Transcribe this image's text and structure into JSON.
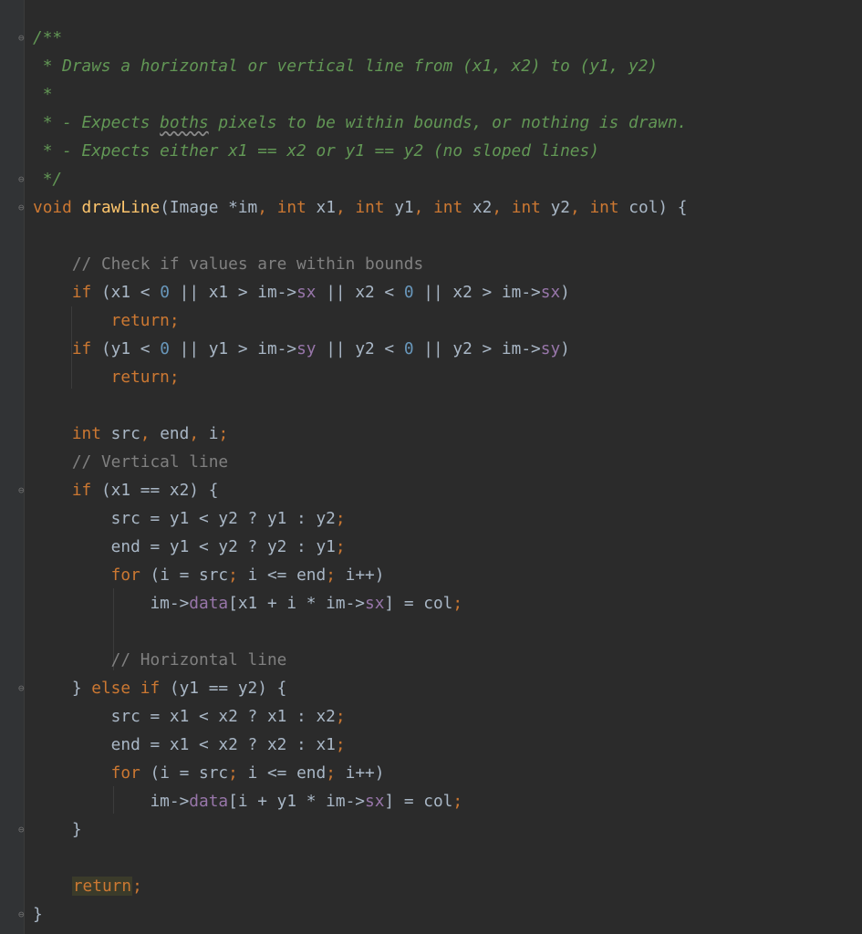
{
  "editor": {
    "lines": [
      [
        "/**"
      ],
      [
        " * Draws a horizontal or vertical line from (x1, x2) to (y1, y2)"
      ],
      [
        " *"
      ],
      [
        " * - Expects ",
        "boths",
        " pixels to be within bounds, or nothing is drawn."
      ],
      [
        " * - Expects either x1 == x2 or y1 == y2 (no sloped lines)"
      ],
      [
        " */"
      ],
      [
        "void",
        " ",
        "drawLine",
        "(Image *im",
        ",",
        " ",
        "int",
        " x1",
        ",",
        " ",
        "int",
        " y1",
        ",",
        " ",
        "int",
        " x2",
        ",",
        " ",
        "int",
        " y2",
        ",",
        " ",
        "int",
        " col) {"
      ],
      [
        ""
      ],
      [
        "    ",
        "// Check if values are within bounds"
      ],
      [
        "    ",
        "if",
        " (x1 < ",
        "0",
        " || x1 > im->",
        "sx",
        " || x2 < ",
        "0",
        " || x2 > im->",
        "sx",
        ")"
      ],
      [
        "        ",
        "return;"
      ],
      [
        "    ",
        "if",
        " (y1 < ",
        "0",
        " || y1 > im->",
        "sy",
        " || y2 < ",
        "0",
        " || y2 > im->",
        "sy",
        ")"
      ],
      [
        "        ",
        "return;"
      ],
      [
        ""
      ],
      [
        "    ",
        "int",
        " src",
        ",",
        " end",
        ",",
        " i",
        ";"
      ],
      [
        "    ",
        "// Vertical line"
      ],
      [
        "    ",
        "if",
        " (x1 == x2) {"
      ],
      [
        "        ",
        "src = y1 < y2 ? y1 : y2",
        ";"
      ],
      [
        "        ",
        "end = y1 < y2 ? y2 : y1",
        ";"
      ],
      [
        "        ",
        "for",
        " (i = src",
        ";",
        " i <= end",
        ";",
        " i++)"
      ],
      [
        "            ",
        "im->",
        "data",
        "[x1 + i * im->",
        "sx",
        "] = col",
        ";"
      ],
      [
        ""
      ],
      [
        "        ",
        "// Horizontal line"
      ],
      [
        "    ",
        "} ",
        "else if",
        " (y1 == y2) {"
      ],
      [
        "        ",
        "src = x1 < x2 ? x1 : x2",
        ";"
      ],
      [
        "        ",
        "end = x1 < x2 ? x2 : x1",
        ";"
      ],
      [
        "        ",
        "for",
        " (i = src",
        ";",
        " i <= end",
        ";",
        " i++)"
      ],
      [
        "            ",
        "im->",
        "data",
        "[i + y1 * im->",
        "sx",
        "] = col",
        ";"
      ],
      [
        "    ",
        "}"
      ],
      [
        ""
      ],
      [
        "    ",
        "return",
        ";"
      ],
      [
        "}"
      ]
    ]
  }
}
